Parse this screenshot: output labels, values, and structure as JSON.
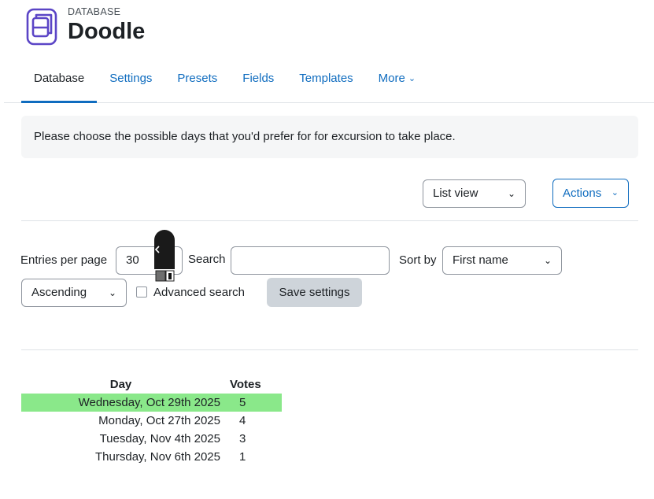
{
  "header": {
    "module_type": "DATABASE",
    "title": "Doodle",
    "icon": "database-icon"
  },
  "tabs": [
    {
      "label": "Database",
      "active": true
    },
    {
      "label": "Settings",
      "active": false
    },
    {
      "label": "Presets",
      "active": false
    },
    {
      "label": "Fields",
      "active": false
    },
    {
      "label": "Templates",
      "active": false
    },
    {
      "label": "More",
      "active": false
    }
  ],
  "intro": {
    "text": "Please choose the possible days that you'd prefer for for excursion to take place."
  },
  "toolbar": {
    "view_select": "List view",
    "actions_label": "Actions"
  },
  "filters": {
    "entries_label": "Entries per page",
    "entries_value": "30",
    "search_label": "Search",
    "search_value": "",
    "sortby_label": "Sort by",
    "sortby_value": "First name",
    "order_value": "Ascending",
    "advanced_label": "Advanced search",
    "advanced_checked": false,
    "save_label": "Save settings"
  },
  "votes": {
    "headers": {
      "day": "Day",
      "votes": "Votes"
    },
    "rows": [
      {
        "day": "Wednesday, Oct 29th 2025",
        "votes": "5",
        "highlight": true
      },
      {
        "day": "Monday, Oct 27th 2025",
        "votes": "4",
        "highlight": false
      },
      {
        "day": "Tuesday, Nov 4th 2025",
        "votes": "3",
        "highlight": false
      },
      {
        "day": "Thursday, Nov 6th 2025",
        "votes": "1",
        "highlight": false
      }
    ]
  },
  "colors": {
    "accent": "#0f6cbf",
    "icon": "#5b45c6",
    "highlight_row": "#8ae88a",
    "intro_bg": "#f5f6f7",
    "save_bg": "#ced4da"
  }
}
